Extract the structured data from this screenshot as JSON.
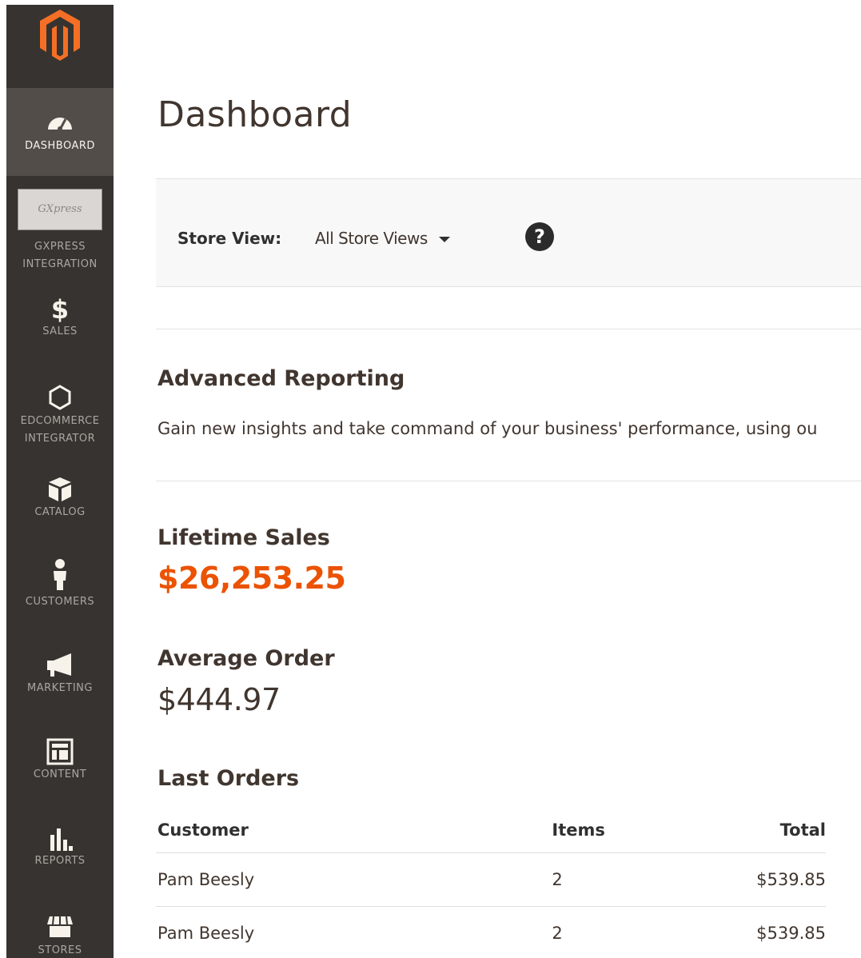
{
  "sidebar": {
    "items": [
      {
        "key": "dashboard",
        "label": "DASHBOARD",
        "icon": "speedometer-icon",
        "active": true
      },
      {
        "key": "gxpress",
        "label": "GXPRESS\nINTEGRATION",
        "icon": "gxpress-logo",
        "logo_text": "GXpress"
      },
      {
        "key": "sales",
        "label": "SALES",
        "icon": "dollar-icon"
      },
      {
        "key": "edcommerce",
        "label": "EDCOMMERCE\nINTEGRATOR",
        "icon": "hexagon-icon"
      },
      {
        "key": "catalog",
        "label": "CATALOG",
        "icon": "box-icon"
      },
      {
        "key": "customers",
        "label": "CUSTOMERS",
        "icon": "person-icon"
      },
      {
        "key": "marketing",
        "label": "MARKETING",
        "icon": "megaphone-icon"
      },
      {
        "key": "content",
        "label": "CONTENT",
        "icon": "layout-icon"
      },
      {
        "key": "reports",
        "label": "REPORTS",
        "icon": "bar-chart-icon"
      },
      {
        "key": "stores",
        "label": "STORES",
        "icon": "store-icon"
      }
    ]
  },
  "header": {
    "title": "Dashboard"
  },
  "store_view": {
    "label": "Store View:",
    "selected": "All Store Views",
    "help": "?"
  },
  "advanced_reporting": {
    "title": "Advanced Reporting",
    "text": "Gain new insights and take command of your business' performance, using ou"
  },
  "lifetime_sales": {
    "title": "Lifetime Sales",
    "value": "$26,253.25"
  },
  "average_order": {
    "title": "Average Order",
    "value": "$444.97"
  },
  "last_orders": {
    "title": "Last Orders",
    "headers": {
      "customer": "Customer",
      "items": "Items",
      "total": "Total"
    },
    "rows": [
      {
        "customer": "Pam Beesly",
        "items": "2",
        "total": "$539.85"
      },
      {
        "customer": "Pam Beesly",
        "items": "2",
        "total": "$539.85"
      }
    ]
  },
  "colors": {
    "sidebar_bg": "#373330",
    "sidebar_active": "#524d49",
    "accent": "#eb5202",
    "logo": "#f46f25"
  }
}
